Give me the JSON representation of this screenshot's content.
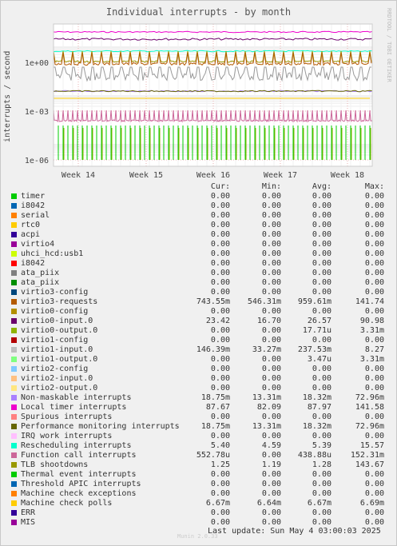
{
  "title": "Individual interrupts - by month",
  "watermark": "RRDTOOL / TOBI OETIKER",
  "footer": {
    "last_update": "Last update: Sun May  4 03:00:03 2025",
    "munin": "Munin 2.0.33"
  },
  "columns": {
    "cur": "Cur:",
    "min": "Min:",
    "avg": "Avg:",
    "max": "Max:"
  },
  "chart_data": {
    "type": "line",
    "ylabel": "interrupts / second",
    "yscale": "log",
    "ytick_labels": [
      "1e+00",
      "1e-03",
      "1e-06"
    ],
    "xtick_labels": [
      "Week 14",
      "Week 15",
      "Week 16",
      "Week 17",
      "Week 18"
    ],
    "grid": true,
    "legend_placement": "bottom",
    "series": [
      {
        "name": "timer",
        "color": "#00cc00",
        "cur": "0.00",
        "min": "0.00",
        "avg": "0.00",
        "max": "0.00"
      },
      {
        "name": "i8042",
        "color": "#0066b3",
        "cur": "0.00",
        "min": "0.00",
        "avg": "0.00",
        "max": "0.00"
      },
      {
        "name": "serial",
        "color": "#ff8000",
        "cur": "0.00",
        "min": "0.00",
        "avg": "0.00",
        "max": "0.00"
      },
      {
        "name": "rtc0",
        "color": "#ffcc00",
        "cur": "0.00",
        "min": "0.00",
        "avg": "0.00",
        "max": "0.00"
      },
      {
        "name": "acpi",
        "color": "#330099",
        "cur": "0.00",
        "min": "0.00",
        "avg": "0.00",
        "max": "0.00"
      },
      {
        "name": "virtio4",
        "color": "#990099",
        "cur": "0.00",
        "min": "0.00",
        "avg": "0.00",
        "max": "0.00"
      },
      {
        "name": "uhci_hcd:usb1",
        "color": "#ccff00",
        "cur": "0.00",
        "min": "0.00",
        "avg": "0.00",
        "max": "0.00"
      },
      {
        "name": "i8042",
        "color": "#ff0000",
        "cur": "0.00",
        "min": "0.00",
        "avg": "0.00",
        "max": "0.00"
      },
      {
        "name": "ata_piix",
        "color": "#808080",
        "cur": "0.00",
        "min": "0.00",
        "avg": "0.00",
        "max": "0.00"
      },
      {
        "name": "ata_piix",
        "color": "#008f00",
        "cur": "0.00",
        "min": "0.00",
        "avg": "0.00",
        "max": "0.00"
      },
      {
        "name": "virtio3-config",
        "color": "#00487d",
        "cur": "0.00",
        "min": "0.00",
        "avg": "0.00",
        "max": "0.00"
      },
      {
        "name": "virtio3-requests",
        "color": "#b35a00",
        "cur": "743.55m",
        "min": "546.31m",
        "avg": "959.61m",
        "max": "141.74"
      },
      {
        "name": "virtio0-config",
        "color": "#b38f00",
        "cur": "0.00",
        "min": "0.00",
        "avg": "0.00",
        "max": "0.00"
      },
      {
        "name": "virtio0-input.0",
        "color": "#6b006b",
        "cur": "23.42",
        "min": "16.70",
        "avg": "26.57",
        "max": "90.98"
      },
      {
        "name": "virtio0-output.0",
        "color": "#8fb300",
        "cur": "0.00",
        "min": "0.00",
        "avg": "17.71u",
        "max": "3.31m"
      },
      {
        "name": "virtio1-config",
        "color": "#b30000",
        "cur": "0.00",
        "min": "0.00",
        "avg": "0.00",
        "max": "0.00"
      },
      {
        "name": "virtio1-input.0",
        "color": "#bebebe",
        "cur": "146.39m",
        "min": "33.27m",
        "avg": "237.53m",
        "max": "8.27"
      },
      {
        "name": "virtio1-output.0",
        "color": "#80ff80",
        "cur": "0.00",
        "min": "0.00",
        "avg": "3.47u",
        "max": "3.31m"
      },
      {
        "name": "virtio2-config",
        "color": "#80c9ff",
        "cur": "0.00",
        "min": "0.00",
        "avg": "0.00",
        "max": "0.00"
      },
      {
        "name": "virtio2-input.0",
        "color": "#ffc080",
        "cur": "0.00",
        "min": "0.00",
        "avg": "0.00",
        "max": "0.00"
      },
      {
        "name": "virtio2-output.0",
        "color": "#ffe680",
        "cur": "0.00",
        "min": "0.00",
        "avg": "0.00",
        "max": "0.00"
      },
      {
        "name": "Non-maskable interrupts",
        "color": "#aa80ff",
        "cur": "18.75m",
        "min": "13.31m",
        "avg": "18.32m",
        "max": "72.96m"
      },
      {
        "name": "Local timer interrupts",
        "color": "#ee00cc",
        "cur": "87.67",
        "min": "82.09",
        "avg": "87.97",
        "max": "141.58"
      },
      {
        "name": "Spurious interrupts",
        "color": "#ff8080",
        "cur": "0.00",
        "min": "0.00",
        "avg": "0.00",
        "max": "0.00"
      },
      {
        "name": "Performance monitoring interrupts",
        "color": "#666600",
        "cur": "18.75m",
        "min": "13.31m",
        "avg": "18.32m",
        "max": "72.96m"
      },
      {
        "name": "IRQ work interrupts",
        "color": "#ffbfff",
        "cur": "0.00",
        "min": "0.00",
        "avg": "0.00",
        "max": "0.00"
      },
      {
        "name": "Rescheduling interrupts",
        "color": "#00ffcc",
        "cur": "5.40",
        "min": "4.59",
        "avg": "5.39",
        "max": "15.57"
      },
      {
        "name": "Function call interrupts",
        "color": "#cc6699",
        "cur": "552.78u",
        "min": "0.00",
        "avg": "438.88u",
        "max": "152.31m"
      },
      {
        "name": "TLB shootdowns",
        "color": "#999900",
        "cur": "1.25",
        "min": "1.19",
        "avg": "1.28",
        "max": "143.67"
      },
      {
        "name": "Thermal event interrupts",
        "color": "#00cc00",
        "cur": "0.00",
        "min": "0.00",
        "avg": "0.00",
        "max": "0.00"
      },
      {
        "name": "Threshold APIC interrupts",
        "color": "#0066b3",
        "cur": "0.00",
        "min": "0.00",
        "avg": "0.00",
        "max": "0.00"
      },
      {
        "name": "Machine check exceptions",
        "color": "#ff8000",
        "cur": "0.00",
        "min": "0.00",
        "avg": "0.00",
        "max": "0.00"
      },
      {
        "name": "Machine check polls",
        "color": "#ffcc00",
        "cur": "6.67m",
        "min": "6.64m",
        "avg": "6.67m",
        "max": "6.69m"
      },
      {
        "name": "ERR",
        "color": "#330099",
        "cur": "0.00",
        "min": "0.00",
        "avg": "0.00",
        "max": "0.00"
      },
      {
        "name": "MIS",
        "color": "#990099",
        "cur": "0.00",
        "min": "0.00",
        "avg": "0.00",
        "max": "0.00"
      }
    ]
  }
}
